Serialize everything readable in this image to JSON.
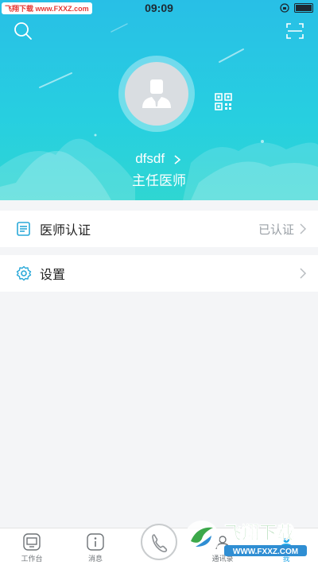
{
  "status_bar": {
    "left_badge": "飞翔下载 www.FXXZ.com",
    "time": "09:09"
  },
  "header": {
    "search_icon": "search-icon",
    "scan_icon": "scan-icon",
    "qr_icon": "qrcode-icon",
    "username": "dfsdf",
    "title": "主任医师",
    "colors": {
      "gradient_top": "#28bfe6",
      "gradient_bottom": "#2fd6d2"
    }
  },
  "menu": {
    "items": [
      {
        "label": "医师认证",
        "value": "已认证",
        "icon": "certificate-icon"
      },
      {
        "label": "设置",
        "value": "",
        "icon": "gear-icon"
      }
    ]
  },
  "tabbar": {
    "tabs": [
      {
        "label": "工作台",
        "icon": "monitor-icon"
      },
      {
        "label": "消息",
        "icon": "info-icon"
      },
      {
        "label": "通讯录",
        "icon": "contacts-icon"
      },
      {
        "label": "我",
        "icon": "profile-icon",
        "active": true
      }
    ],
    "call_icon": "phone-icon",
    "accent": "#22a7e8"
  },
  "watermark": {
    "brand": "飞翔下载",
    "url": "WWW.FXXZ.COM"
  }
}
